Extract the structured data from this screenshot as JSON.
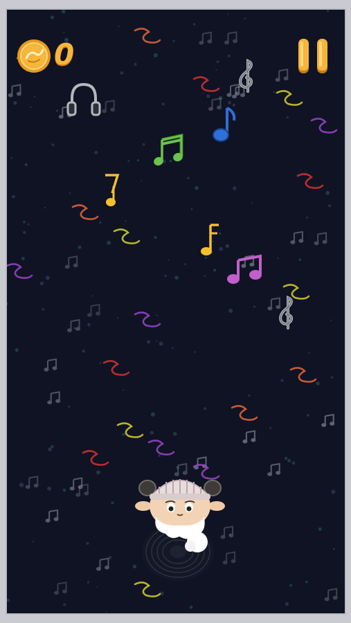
{
  "hud": {
    "score": "0",
    "coin_icon": "coin-icon",
    "pause_icon": "pause-icon"
  },
  "colors": {
    "background": "#0f1324",
    "frame": "#c9cbd1",
    "coin": "#f6b53b",
    "note_green": "#6cc24a",
    "note_blue": "#2f6fd8",
    "note_purple": "#c25fc9",
    "note_yellow": "#f5c02e",
    "note_gray": "#9aa0a8",
    "streamer_orange": "#e5683a",
    "streamer_yellow": "#d7d12a",
    "streamer_purple": "#9a47c9",
    "streamer_red": "#d8332f"
  },
  "collectibles": [
    {
      "kind": "music-note-icon",
      "color": "green"
    },
    {
      "kind": "music-note-icon",
      "color": "blue"
    },
    {
      "kind": "music-note-icon",
      "color": "yellow"
    },
    {
      "kind": "music-note-icon",
      "color": "yellow"
    },
    {
      "kind": "music-note-icon",
      "color": "purple"
    },
    {
      "kind": "treble-clef-icon",
      "color": "gray"
    },
    {
      "kind": "treble-clef-icon",
      "color": "gray"
    },
    {
      "kind": "headphones-icon",
      "color": "gray"
    }
  ],
  "player": {
    "character": "sheep-character"
  }
}
